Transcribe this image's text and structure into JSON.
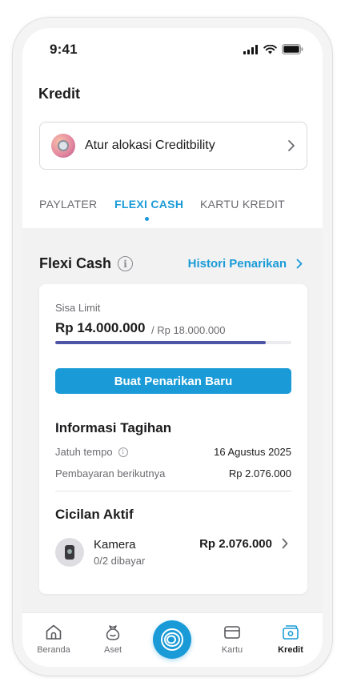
{
  "status_bar": {
    "time": "9:41"
  },
  "header": {
    "title": "Kredit"
  },
  "allocation": {
    "label": "Atur alokasi Creditbility"
  },
  "tabs": [
    {
      "label": "PAYLATER",
      "active": false
    },
    {
      "label": "FLEXI CASH",
      "active": true
    },
    {
      "label": "KARTU KREDIT",
      "active": false
    }
  ],
  "flexi_cash": {
    "title": "Flexi Cash",
    "history_link": "Histori Penarikan",
    "limit_label": "Sisa Limit",
    "limit_amount": "Rp 14.000.000",
    "limit_total": "/ Rp 18.000.000",
    "limit_used_fraction": 0.89,
    "cta_label": "Buat Penarikan Baru"
  },
  "billing": {
    "title": "Informasi Tagihan",
    "rows": [
      {
        "label": "Jatuh tempo",
        "value": "16 Agustus 2025",
        "has_info": true
      },
      {
        "label": "Pembayaran berikutnya",
        "value": "Rp 2.076.000",
        "has_info": false
      }
    ]
  },
  "installments": {
    "title": "Cicilan Aktif",
    "items": [
      {
        "name": "Kamera",
        "progress": "0/2 dibayar",
        "amount": "Rp 2.076.000"
      }
    ]
  },
  "bottom_nav": {
    "items": [
      {
        "label": "Beranda",
        "icon": "home-icon",
        "active": false
      },
      {
        "label": "Aset",
        "icon": "money-bag-icon",
        "active": false
      },
      {
        "label": "Kartu",
        "icon": "card-icon",
        "active": false
      },
      {
        "label": "Kredit",
        "icon": "wallet-icon",
        "active": true
      }
    ]
  },
  "colors": {
    "accent": "#1a9bd7",
    "progress": "#4d55a6",
    "background": "#f2f2f3"
  }
}
